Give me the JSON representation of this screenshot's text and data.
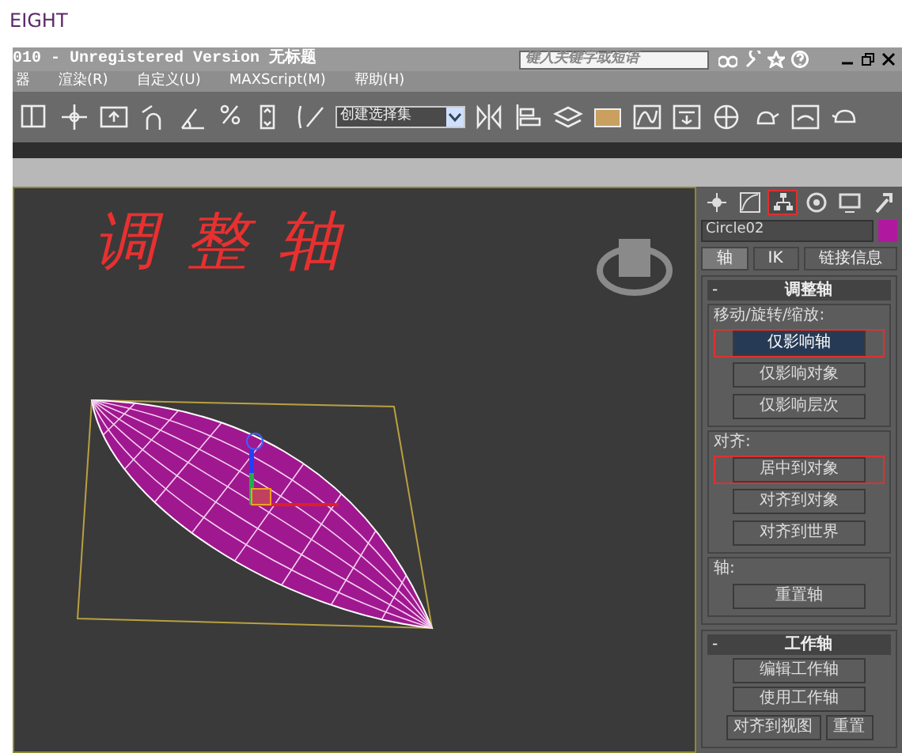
{
  "page": {
    "heading": "EIGHT"
  },
  "window": {
    "title": "010  - Unregistered Version  无标题",
    "search": {
      "placeholder": "键入关键字或短语"
    }
  },
  "menu": [
    "器",
    "渲染(R)",
    "自定义(U)",
    "MAXScript(M)",
    "帮助(H)"
  ],
  "toolbar": {
    "selection_set": "创建选择集"
  },
  "viewport": {
    "annotation": "调整轴"
  },
  "command_panel": {
    "tabs": [
      {
        "selected": false
      },
      {
        "selected": false
      },
      {
        "selected": true
      },
      {
        "selected": false
      },
      {
        "selected": false
      },
      {
        "selected": false
      }
    ],
    "object_name": "Circle02",
    "subtabs": [
      {
        "label": "轴",
        "selected": true
      },
      {
        "label": "IK",
        "selected": false
      },
      {
        "label": "链接信息",
        "selected": false
      }
    ],
    "rollouts": [
      {
        "toggle": "-",
        "title": "调整轴",
        "groups": [
          {
            "label": "移动/旋转/缩放:",
            "buttons": [
              {
                "label": "仅影响轴",
                "pressed": true,
                "highlighted": true
              },
              {
                "label": "仅影响对象",
                "pressed": false,
                "highlighted": false
              },
              {
                "label": "仅影响层次",
                "pressed": false,
                "highlighted": false
              }
            ]
          },
          {
            "label": "对齐:",
            "buttons": [
              {
                "label": "居中到对象",
                "pressed": false,
                "highlighted": true
              },
              {
                "label": "对齐到对象",
                "pressed": false,
                "highlighted": false
              },
              {
                "label": "对齐到世界",
                "pressed": false,
                "highlighted": false
              }
            ]
          },
          {
            "label": "轴:",
            "buttons": [
              {
                "label": "重置轴",
                "pressed": false,
                "highlighted": false
              }
            ]
          }
        ]
      },
      {
        "toggle": "-",
        "title": "工作轴",
        "rows": [
          [
            "编辑工作轴"
          ],
          [
            "使用工作轴"
          ],
          [
            "对齐到视图",
            "重置"
          ]
        ]
      }
    ]
  }
}
